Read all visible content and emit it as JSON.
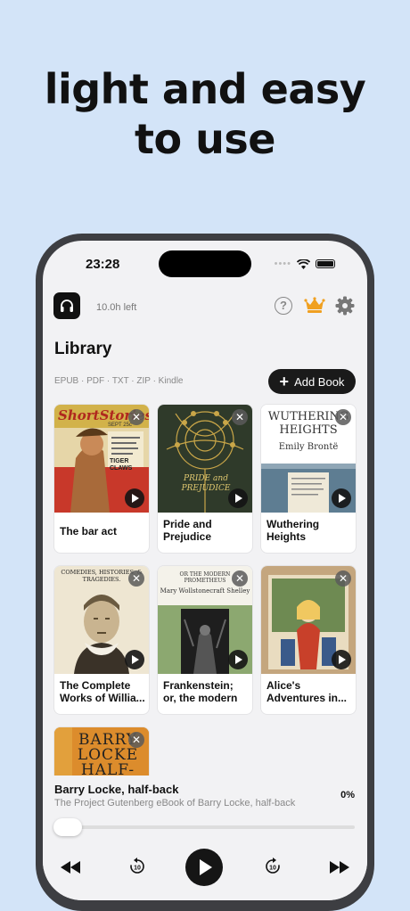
{
  "headline": {
    "line1": "light and easy",
    "line2": "to use"
  },
  "status": {
    "time": "23:28"
  },
  "topbar": {
    "time_left": "10.0h left"
  },
  "library": {
    "title": "Library",
    "formats": "EPUB · PDF · TXT · ZIP · Kindle",
    "add_label": "Add Book"
  },
  "books": [
    {
      "title": "The bar act"
    },
    {
      "title": "Pride and Prejudice"
    },
    {
      "title": "Wuthering Heights"
    },
    {
      "title": "The Complete Works of Willia..."
    },
    {
      "title": "Frankenstein; or, the modern pr..."
    },
    {
      "title": "Alice's Adventures in..."
    },
    {
      "title": ""
    }
  ],
  "covers": {
    "short_stories": "ShortStories",
    "short_stories_sub": "SEPT 25c",
    "tiger": "TIGER CLAWS",
    "pride": "PRIDE and PREJUDICE",
    "wuthering": "WUTHERING HEIGHTS",
    "bronte": "Emily Brontë",
    "complete_works": "COMEDIES, HISTORIES, & TRAGEDIES.",
    "frankenstein_top": "OR THE MODERN PROMETHEUS",
    "shelley": "Mary Wollstonecraft Shelley",
    "barry": "BARRY LOCKE HALF-BACK"
  },
  "player": {
    "title": "Barry Locke, half-back",
    "subtitle": "The Project Gutenberg eBook of Barry Locke, half-back",
    "percent": "0%",
    "progress": 0
  },
  "colors": {
    "background": "#d3e4f8",
    "accent": "#f0a020",
    "dark": "#151515"
  }
}
